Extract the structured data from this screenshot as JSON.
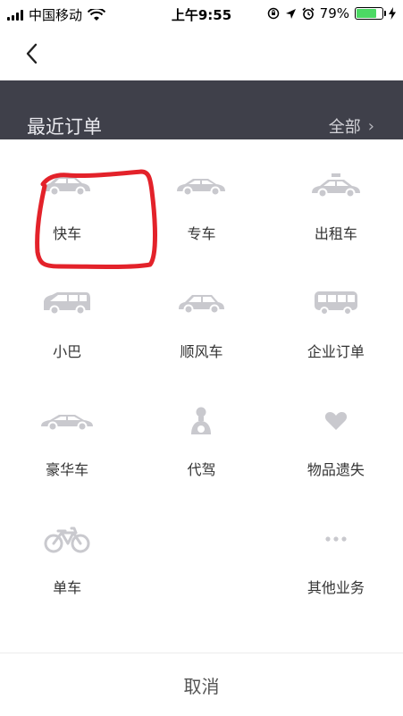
{
  "status_bar": {
    "carrier": "中国移动",
    "time": "上午9:55",
    "battery_percent": "79%",
    "battery_level": 0.79,
    "icons": [
      "signal-icon",
      "wifi-icon",
      "orientation-lock-icon",
      "location-icon",
      "alarm-icon",
      "battery-icon",
      "charging-icon"
    ]
  },
  "nav": {
    "back_icon": "chevron-left-icon"
  },
  "orders": {
    "title": "最近订单",
    "all_label": "全部"
  },
  "services": [
    {
      "label": "快车",
      "icon": "car-icon"
    },
    {
      "label": "专车",
      "icon": "premium-car-icon"
    },
    {
      "label": "出租车",
      "icon": "taxi-icon"
    },
    {
      "label": "小巴",
      "icon": "minivan-icon"
    },
    {
      "label": "顺风车",
      "icon": "hatchback-icon"
    },
    {
      "label": "企业订单",
      "icon": "bus-icon"
    },
    {
      "label": "豪华车",
      "icon": "luxury-car-icon"
    },
    {
      "label": "代驾",
      "icon": "designated-driver-icon"
    },
    {
      "label": "物品遗失",
      "icon": "heart-icon"
    },
    {
      "label": "单车",
      "icon": "bicycle-icon"
    },
    {
      "label": "",
      "icon": ""
    },
    {
      "label": "其他业务",
      "icon": "more-icon"
    }
  ],
  "cancel_label": "取消",
  "colors": {
    "header_bg": "#3f404a",
    "icon_gray": "#c9c9ce",
    "annotation_red": "#e3222a",
    "battery_green": "#4cd964"
  }
}
